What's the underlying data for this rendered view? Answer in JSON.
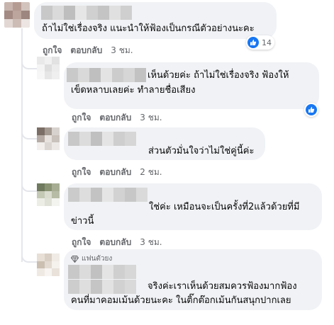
{
  "comments": [
    {
      "text_lines": [
        "ถ้าไม่ใช่เรื่องจริง แนะนำให้ฟ้องเป็นกรณีตัวอย่างนะคะ"
      ],
      "like_label": "ถูกใจ",
      "reply_label": "ตอบกลับ",
      "time": "3 ชม.",
      "reaction_count": "14"
    },
    {
      "text_lines": [
        "เห็นด้วยค่ะ ถ้าไม่ใช่เรื่องจริง ฟ้องให้",
        "เข็ดหลาบเลยค่ะ ทำลายชื่อเสียง"
      ],
      "like_label": "ถูกใจ",
      "reply_label": "ตอบกลับ",
      "time": "3 ชม."
    },
    {
      "text_lines": [
        "ส่วนตัวมั่นใจว่าไม่ใช่คู่นี้ค่ะ"
      ],
      "like_label": "ถูกใจ",
      "reply_label": "ตอบกลับ",
      "time": "2 ชม."
    },
    {
      "text_lines": [
        "ใช่ค่ะ เหมือนจะเป็นครั้งที่2แล้วด้วยที่มี",
        "ข่าวนี้"
      ],
      "like_label": "ถูกใจ",
      "reply_label": "ตอบกลับ",
      "time": "3 ชม."
    },
    {
      "badge": "แฟนตัวยง",
      "text_lines": [
        "จริงค่ะเราเห็นด้วยสมควรฟ้องมากฟ้อง",
        "คนที่มาคอมเม้นด้วยนะคะ ในติ๊กต๊อกเม้นกันสนุกปากเลย"
      ]
    }
  ],
  "colors": {
    "bubble": "#f0f2f5",
    "meta_text": "#65676b",
    "like_blue": "#1877f2"
  },
  "icons": [
    "like-icon",
    "diamond-icon"
  ]
}
